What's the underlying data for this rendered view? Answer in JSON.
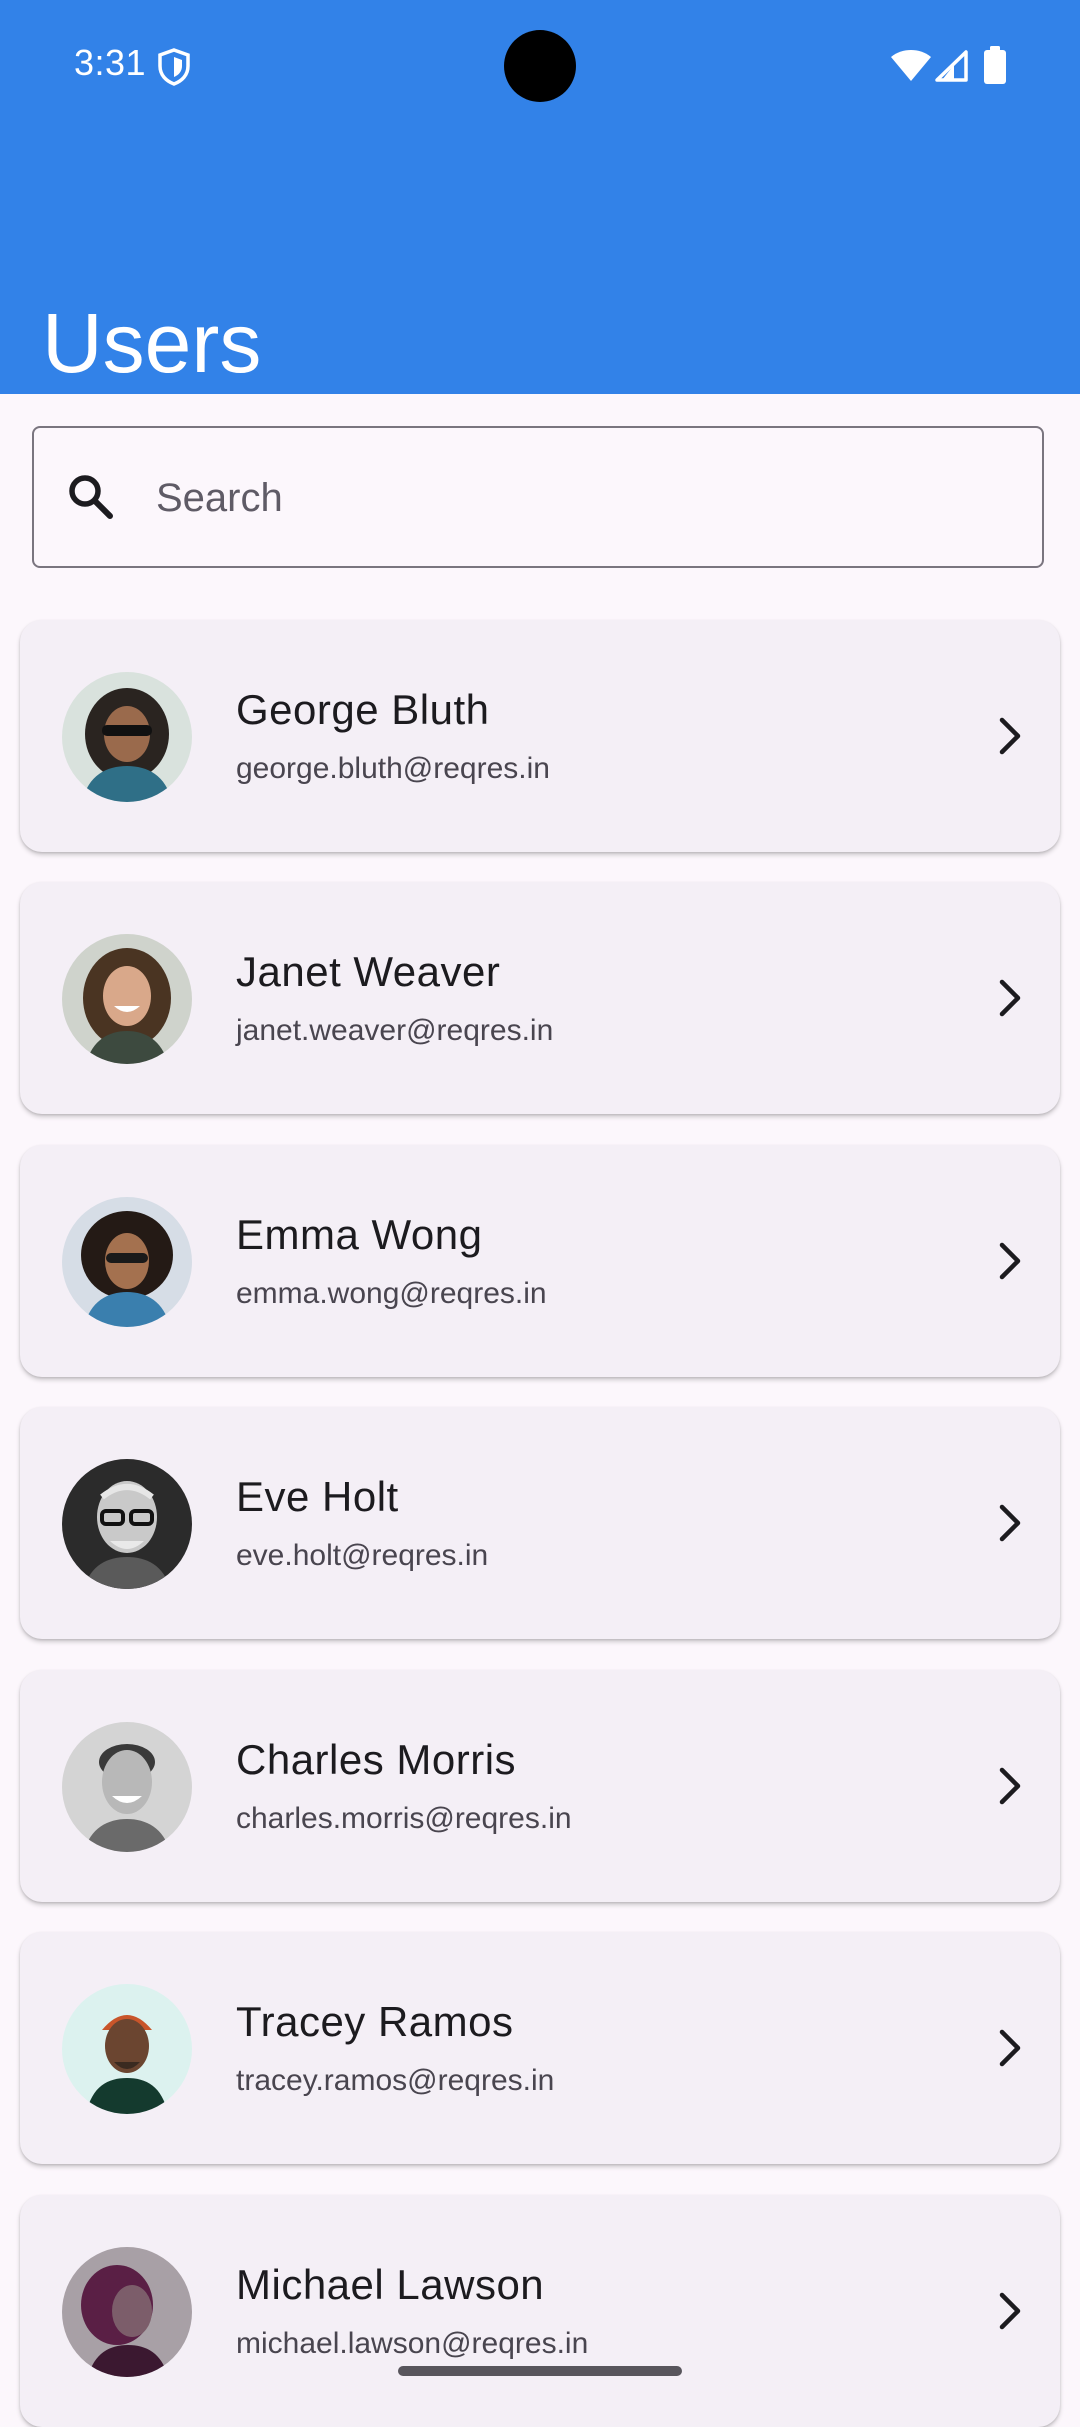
{
  "status_bar": {
    "time": "3:31"
  },
  "app_bar": {
    "title": "Users"
  },
  "search": {
    "placeholder": "Search"
  },
  "users": [
    {
      "name": "George Bluth",
      "email": "george.bluth@reqres.in"
    },
    {
      "name": "Janet Weaver",
      "email": "janet.weaver@reqres.in"
    },
    {
      "name": "Emma Wong",
      "email": "emma.wong@reqres.in"
    },
    {
      "name": "Eve Holt",
      "email": "eve.holt@reqres.in"
    },
    {
      "name": "Charles Morris",
      "email": "charles.morris@reqres.in"
    },
    {
      "name": "Tracey Ramos",
      "email": "tracey.ramos@reqres.in"
    },
    {
      "name": "Michael Lawson",
      "email": "michael.lawson@reqres.in"
    }
  ],
  "icons": {
    "status": [
      "shield-icon",
      "wifi-icon",
      "signal-icon",
      "battery-icon"
    ],
    "search": "search-icon",
    "row_action": "chevron-right-icon"
  },
  "colors": {
    "app_bar": "#3282e8",
    "background": "#fcf7fc",
    "card": "#f4eff6",
    "title_text": "#ffffff",
    "primary_text": "#1c1b1f",
    "secondary_text": "#49454f"
  }
}
